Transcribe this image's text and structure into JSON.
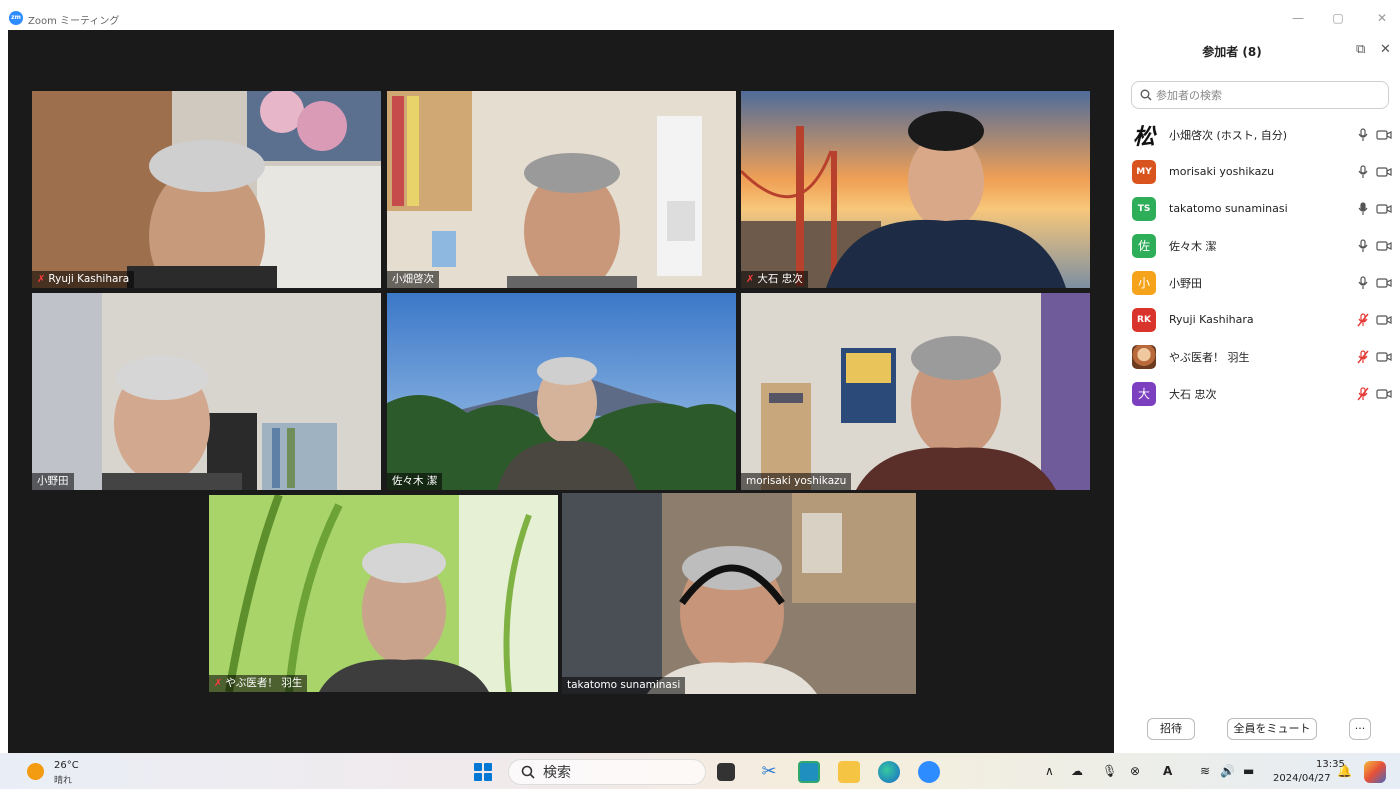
{
  "window": {
    "title": "Zoom ミーティング",
    "logo_label": "zm",
    "controls": {
      "minimize": "—",
      "restore": "▢",
      "close": "✕"
    }
  },
  "tiles": [
    {
      "name": "Ryuji Kashihara",
      "muted": true
    },
    {
      "name": "小畑啓次",
      "muted": false
    },
    {
      "name": "大石 忠次",
      "muted": true
    },
    {
      "name": "小野田",
      "muted": false
    },
    {
      "name": "佐々木 潔",
      "muted": false
    },
    {
      "name": "morisaki yoshikazu",
      "muted": false
    },
    {
      "name": "やぶ医者！ 羽生",
      "muted": true
    },
    {
      "name": "takatomo sunaminasi",
      "muted": false,
      "active_speaker": true
    }
  ],
  "panel": {
    "title": "参加者 (8)",
    "popout_icon": "popout-icon",
    "close_icon": "close-icon",
    "search_placeholder": "参加者の検索",
    "participants": [
      {
        "avatar": "松",
        "avatar_style": "calligraphy",
        "name": "小畑啓次 (ホスト, 自分)",
        "mic": "on"
      },
      {
        "avatar": "MY",
        "color": "#d9531e",
        "name": "morisaki yoshikazu",
        "mic": "on"
      },
      {
        "avatar": "TS",
        "color": "#2fae5a",
        "name": "takatomo sunaminasi",
        "mic": "speaking"
      },
      {
        "avatar": "佐",
        "color": "#2fae5a",
        "name": "佐々木 潔",
        "mic": "on"
      },
      {
        "avatar": "小",
        "color": "#f5a31a",
        "name": "小野田",
        "mic": "on"
      },
      {
        "avatar": "RK",
        "color": "#d9342b",
        "name": "Ryuji Kashihara",
        "mic": "muted"
      },
      {
        "avatar": "",
        "avatar_style": "photo",
        "name": "やぶ医者！ 羽生",
        "mic": "muted"
      },
      {
        "avatar": "大",
        "color": "#7b3fbf",
        "name": "大石 忠次",
        "mic": "muted"
      }
    ],
    "buttons": {
      "invite": "招待",
      "mute_all": "全員をミュート",
      "more": "···"
    }
  },
  "taskbar": {
    "weather_temp": "26°C",
    "weather_cond": "晴れ",
    "search_label": "検索",
    "time": "13:35",
    "date": "2024/04/27",
    "tray_icons": [
      "chevron-up-icon",
      "cloud-icon",
      "mic-icon",
      "record-icon",
      "font-icon",
      "wifi-icon",
      "speaker-icon",
      "battery-icon"
    ]
  },
  "colors": {
    "accent": "#2d8cff",
    "active_speaker_border": "#dce775",
    "muted_red": "#ff3b3b",
    "video_bg": "#1a1a1a"
  }
}
